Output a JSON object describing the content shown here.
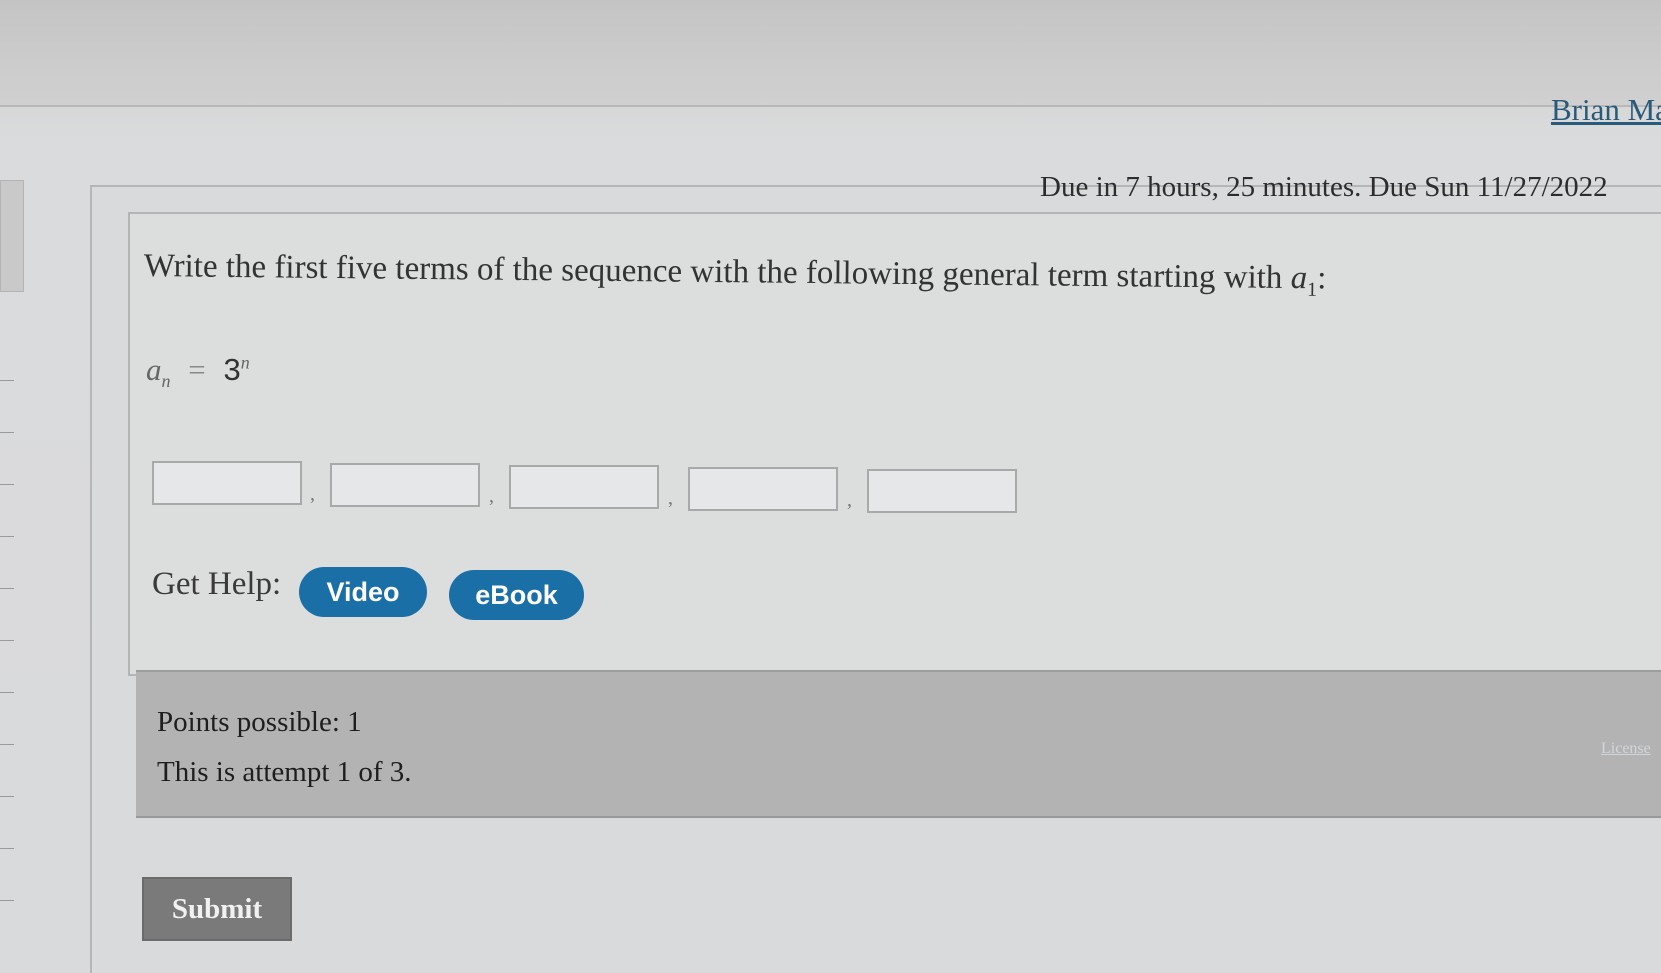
{
  "header": {
    "user_name": "Brian Ma"
  },
  "assignment": {
    "due_text": "Due in 7 hours, 25 minutes. Due Sun 11/27/2022"
  },
  "question": {
    "prompt_prefix": "Write the first five terms of the sequence with the following general term starting with ",
    "prompt_var": "a",
    "prompt_sub": "1",
    "prompt_suffix": ":",
    "formula_lhs_var": "a",
    "formula_lhs_sub": "n",
    "formula_eq": "=",
    "formula_base": "3",
    "formula_exp": "n",
    "answers": [
      "",
      "",
      "",
      "",
      ""
    ],
    "separator": ","
  },
  "help": {
    "label": "Get Help:",
    "video_label": "Video",
    "ebook_label": "eBook"
  },
  "points": {
    "possible_text": "Points possible: 1",
    "attempt_text": "This is attempt 1 of 3."
  },
  "footer": {
    "license_label": "License",
    "submit_label": "Submit"
  },
  "colors": {
    "help_button": "#1a6fa6",
    "submit_button": "#7a7a7a",
    "points_panel": "#b3b3b3",
    "user_link": "#2a5a7a"
  }
}
